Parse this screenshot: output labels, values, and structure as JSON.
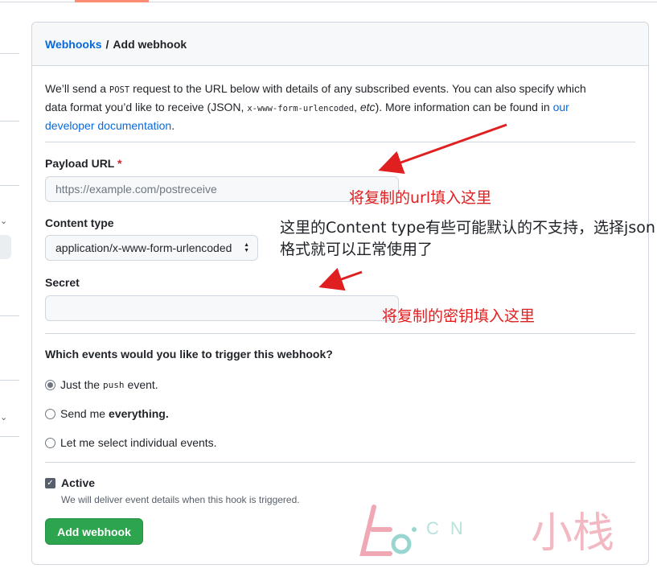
{
  "breadcrumb": {
    "parent": "Webhooks",
    "separator": "/",
    "current": "Add webhook"
  },
  "intro": {
    "p1": "We’ll send a ",
    "code1": "POST",
    "p2": " request to the URL below with details of any subscribed events. You can also specify which data format you’d like to receive (JSON, ",
    "code2": "x-www-form-urlencoded",
    "p3": ", ",
    "etc": "etc",
    "p4": "). More information can be found in ",
    "link": "our developer documentation",
    "p5": "."
  },
  "payload": {
    "label": "Payload URL",
    "required_mark": "*",
    "placeholder": "https://example.com/postreceive"
  },
  "content_type": {
    "label": "Content type",
    "selected": "application/x-www-form-urlencoded"
  },
  "secret": {
    "label": "Secret",
    "value": ""
  },
  "events": {
    "question": "Which events would you like to trigger this webhook?",
    "opt1_pre": "Just the",
    "opt1_code": "push",
    "opt1_post": "event.",
    "opt2_pre": "Send me",
    "opt2_bold": "everything.",
    "opt3": "Let me select individual events.",
    "selected_index": 0
  },
  "active": {
    "label": "Active",
    "checked": true,
    "note": "We will deliver event details when this hook is triggered."
  },
  "submit_label": "Add webhook",
  "annotations": {
    "url_note": "将复制的url填入这里",
    "content_type_note": "这里的Content type有些可能默认的不支持，选择json格式就可以正常使用了",
    "secret_note": "将复制的密钥填入这里",
    "color": "#e02020"
  },
  "watermark": {
    "latin": "CN",
    "chinese": "小栈"
  },
  "colors": {
    "accent": "#0969da",
    "primary_button": "#2da44e",
    "required": "#cf222e"
  }
}
